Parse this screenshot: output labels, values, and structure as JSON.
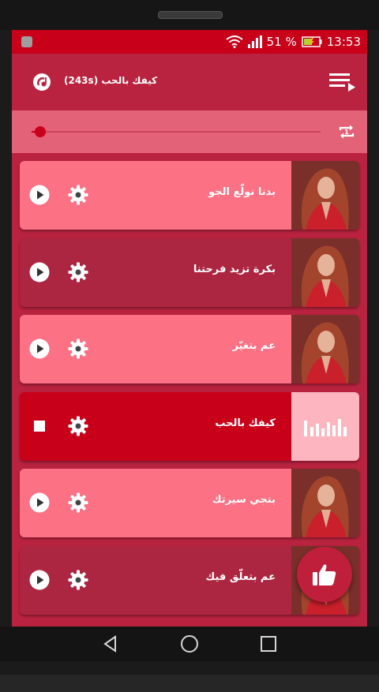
{
  "status_bar": {
    "battery_percent": "51 %",
    "time": "13:53"
  },
  "toolbar": {
    "title": "كيفك بالحب (243s)",
    "logo_icon": "app-logo-icon",
    "menu_icon": "playlist-menu-icon"
  },
  "player": {
    "progress_fraction": 0.03,
    "repeat_icon": "repeat-one-icon",
    "repeat_badge": "1"
  },
  "songs": [
    {
      "title": "بدنا نولّع الجو",
      "state": "idle"
    },
    {
      "title": "بكرة تزيد فرحتنا",
      "state": "idle"
    },
    {
      "title": "عم بتغيّر",
      "state": "idle"
    },
    {
      "title": "كيفك بالحب",
      "state": "playing"
    },
    {
      "title": "بتجي سيرتك",
      "state": "idle"
    },
    {
      "title": "عم بتعلّق فيك",
      "state": "idle"
    }
  ],
  "fab": {
    "icon": "thumbs-up-icon"
  },
  "colors": {
    "status_bar": "#c8001a",
    "toolbar": "#b9233f",
    "card_light": "#fc7184",
    "card_dark": "#ad2641",
    "card_active": "#c8001a"
  }
}
